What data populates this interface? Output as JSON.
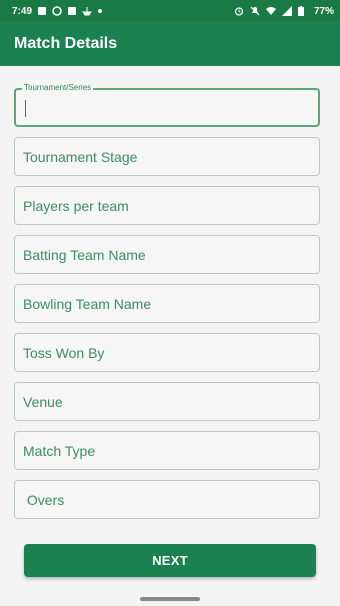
{
  "status_bar": {
    "time": "7:49",
    "battery": "77%",
    "left_icons": [
      "photo-icon",
      "whatsapp-icon",
      "download-icon",
      "ship-icon",
      "dot-icon"
    ],
    "right_icons": [
      "alarm-icon",
      "mute-icon",
      "wifi-icon",
      "signal-icon",
      "battery-icon"
    ]
  },
  "app_bar": {
    "title": "Match Details"
  },
  "form": {
    "tournament_label": "Tournament/Series",
    "tournament_value": "",
    "fields": [
      {
        "placeholder": "Tournament Stage"
      },
      {
        "placeholder": "Players per team"
      },
      {
        "placeholder": "Batting Team Name"
      },
      {
        "placeholder": "Bowling Team Name"
      },
      {
        "placeholder": "Toss Won By"
      },
      {
        "placeholder": "Venue"
      },
      {
        "placeholder": "Match Type"
      },
      {
        "placeholder": " Overs"
      }
    ]
  },
  "next_button": {
    "label": "NEXT"
  },
  "colors": {
    "primary": "#1b8150",
    "status_bar": "#1a7a45",
    "field_text": "#3c8d60",
    "field_border": "#b9c9bf"
  }
}
